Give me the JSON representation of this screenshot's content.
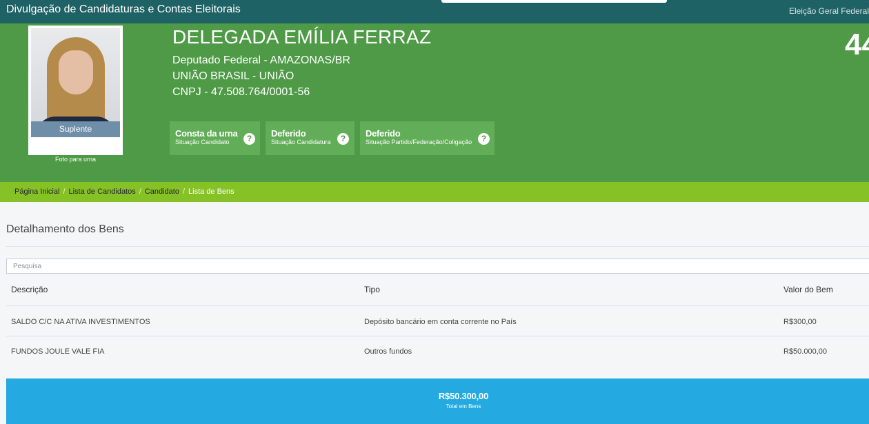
{
  "app": {
    "title": "Divulgação de Candidaturas e Contas Eleitorais",
    "election": "Eleição Geral Federal"
  },
  "candidate": {
    "name": "DELEGADA EMÍLIA FERRAZ",
    "office": "Deputado Federal - AMAZONAS/BR",
    "party": "UNIÃO BRASIL - UNIÃO",
    "cnpj": "CNPJ - 47.508.764/0001-56",
    "number": "44",
    "photo_status": "Suplente",
    "photo_caption": "Foto para urna"
  },
  "statuses": [
    {
      "main": "Consta da urna",
      "sub": "Situação Candidato",
      "icon": "question-icon"
    },
    {
      "main": "Deferido",
      "sub": "Situação Candidatura",
      "icon": "question-icon"
    },
    {
      "main": "Deferido",
      "sub": "Situação Partido/Federação/Coligação",
      "icon": "question-icon"
    }
  ],
  "breadcrumb": {
    "items": [
      "Página Inicial",
      "Lista de Candidatos",
      "Candidato"
    ],
    "current": "Lista de Bens"
  },
  "assets": {
    "title": "Detalhamento dos Bens",
    "search_placeholder": "Pesquisa",
    "columns": [
      "Descrição",
      "Tipo",
      "Valor do Bem"
    ],
    "rows": [
      {
        "descricao": "SALDO C/C NA ATIVA INVESTIMENTOS",
        "tipo": "Depósito bancário em conta corrente no País",
        "valor": "R$300,00"
      },
      {
        "descricao": "FUNDOS JOULE VALE FIA",
        "tipo": "Outros fundos",
        "valor": "R$50.000,00"
      }
    ],
    "total": "R$50.300,00",
    "total_label": "Total em Bens"
  },
  "colors": {
    "topbar": "#1f6265",
    "header": "#4e9a46",
    "breadcrumb": "#86c226",
    "total": "#24aae1"
  }
}
